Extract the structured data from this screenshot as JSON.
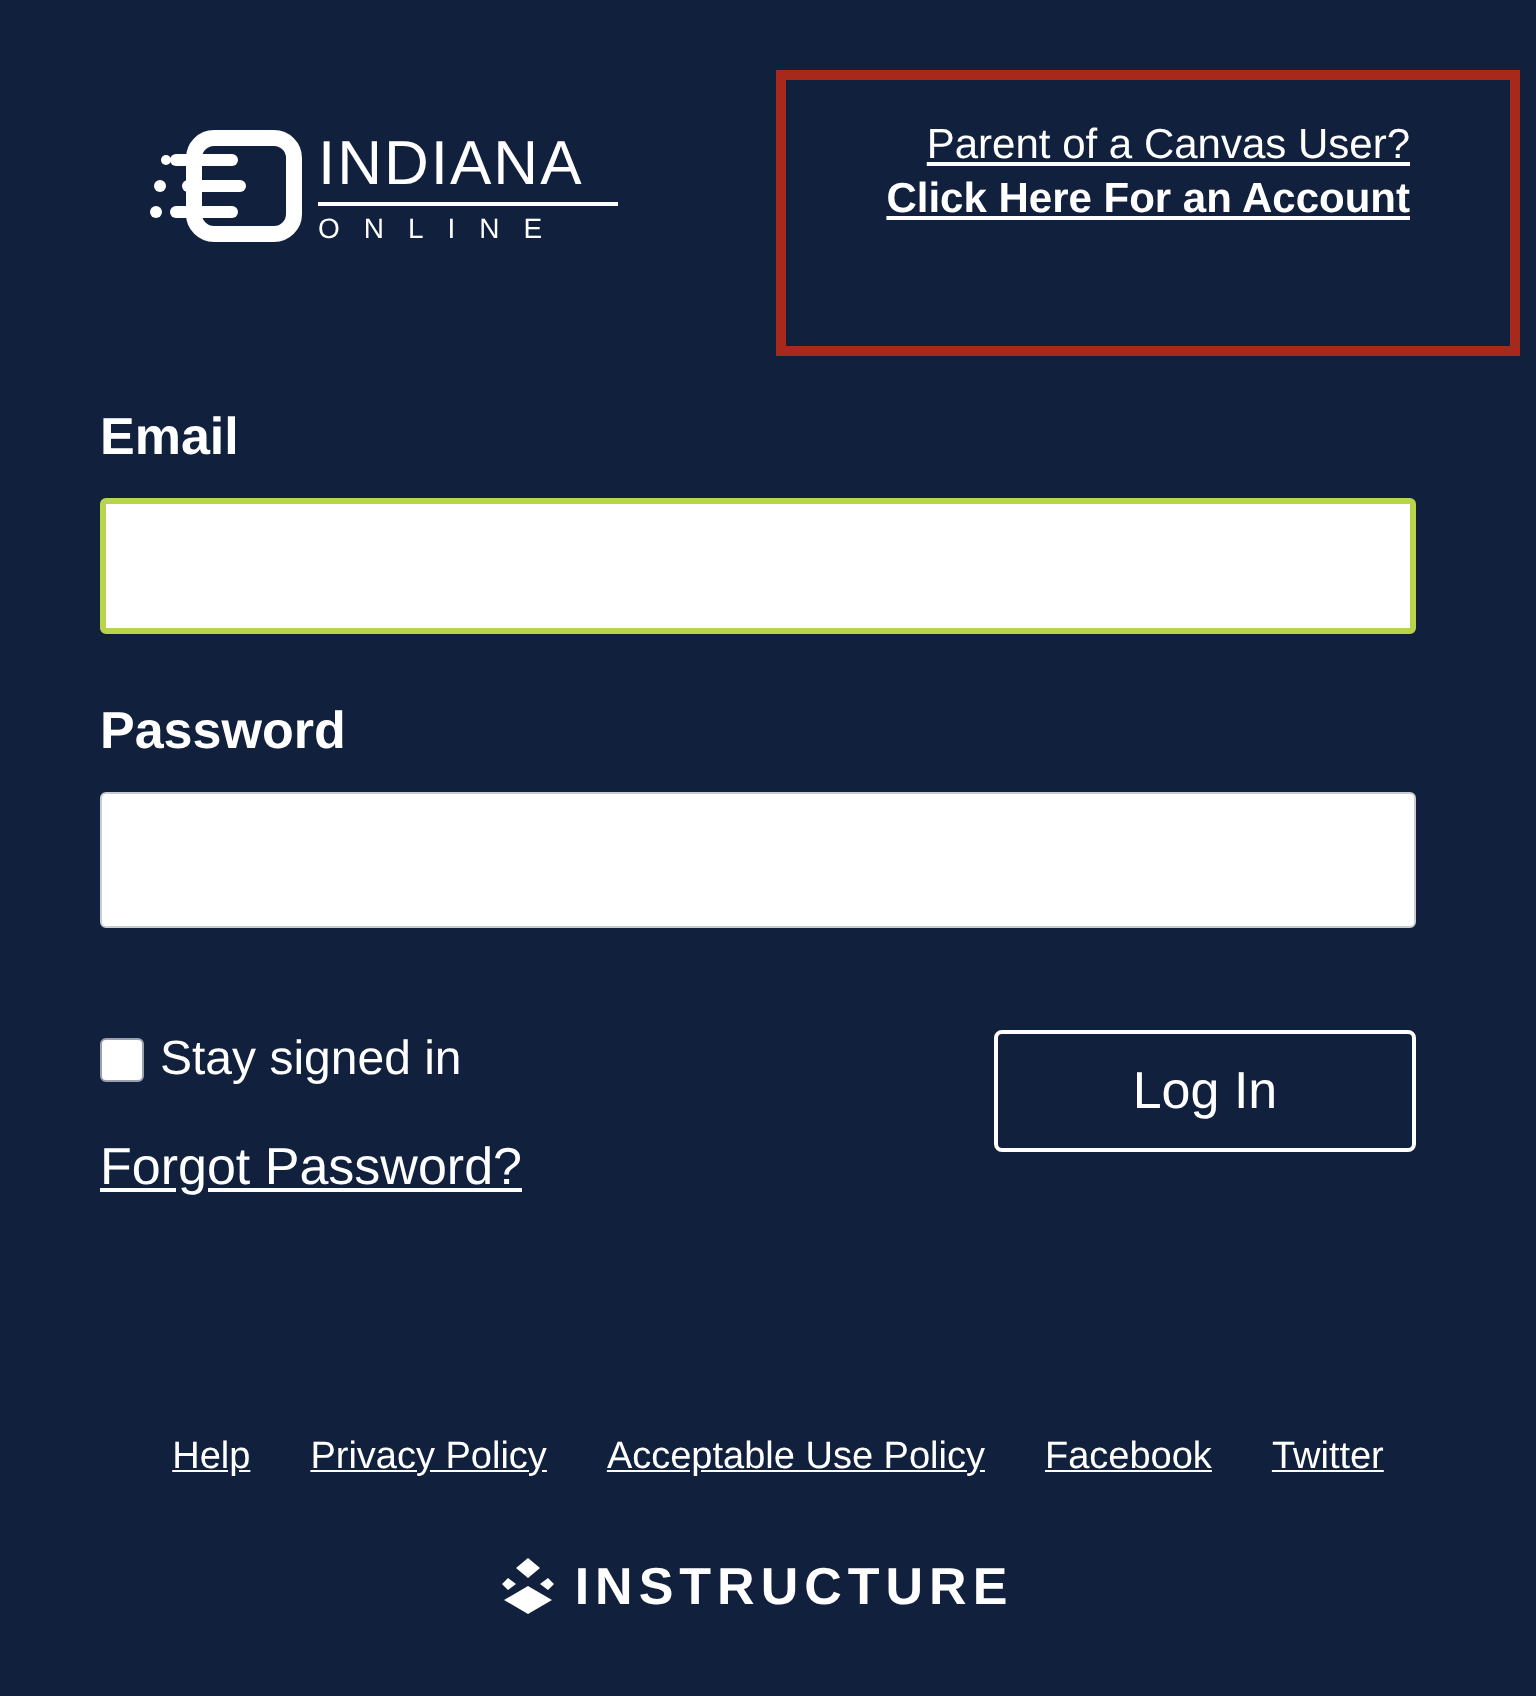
{
  "logo": {
    "title": "INDIANA",
    "subtitle": "ONLINE"
  },
  "parent_link": {
    "line1": "Parent of a Canvas User?",
    "line2": "Click Here For an Account",
    "highlighted": true
  },
  "email": {
    "label": "Email",
    "focused": true
  },
  "password": {
    "label": "Password",
    "focused": false
  },
  "stay_signed_in": {
    "label": "Stay signed in",
    "checked": false
  },
  "login_button": "Log In",
  "forgot_link": "Forgot Password?",
  "footer_links": [
    "Help",
    "Privacy Policy",
    "Acceptable Use Policy",
    "Facebook",
    "Twitter"
  ],
  "brand": "INSTRUCTURE"
}
